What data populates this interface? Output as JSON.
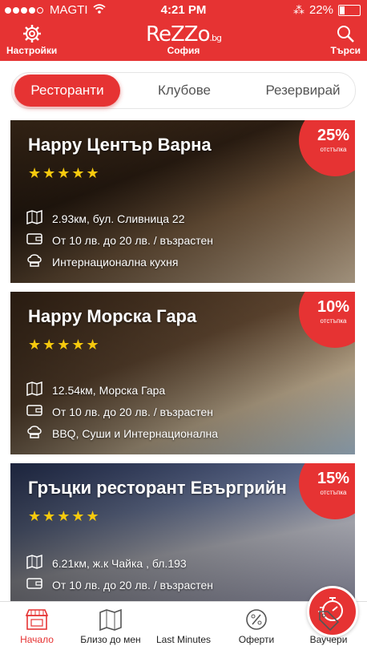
{
  "status_bar": {
    "carrier": "MAGTI",
    "time": "4:21 PM",
    "battery": "22%"
  },
  "header": {
    "settings_label": "Настройки",
    "search_label": "Търси",
    "logo_text": "ReZZo",
    "logo_suffix": ".bg",
    "city": "София"
  },
  "tabs": [
    "Ресторанти",
    "Клубове",
    "Резервирай"
  ],
  "cards": [
    {
      "title": "Happy Център Варна",
      "rating": 5,
      "distance_address": "2.93км, бул. Сливница 22",
      "price": "От 10 лв. до 20 лв. / възрастен",
      "cuisine": "Интернационална кухня",
      "discount": "25%",
      "discount_label": "отстъпка"
    },
    {
      "title": "Happy Морска Гара",
      "rating": 5,
      "distance_address": "12.54км, Морска Гара",
      "price": "От 10 лв. до 20 лв. / възрастен",
      "cuisine": "BBQ, Суши и Интернационална",
      "discount": "10%",
      "discount_label": "отстъпка"
    },
    {
      "title": "Гръцки ресторант Евъргрийн",
      "rating": 5,
      "distance_address": "6.21км, ж.к Чайка , бл.193",
      "price": "От 10 лв. до 20 лв. / възрастен",
      "discount": "15%",
      "discount_label": "отстъпка"
    }
  ],
  "bottom_nav": [
    "Начало",
    "Близо до мен",
    "Last Minutes",
    "Оферти",
    "Ваучери"
  ],
  "colors": {
    "accent": "#e63333",
    "star": "#f6c90e"
  }
}
